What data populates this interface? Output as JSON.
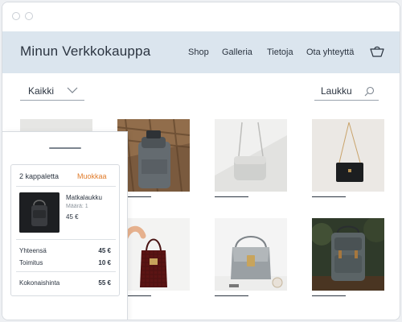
{
  "store": {
    "title": "Minun Verkkokauppa"
  },
  "nav": {
    "shop": "Shop",
    "gallery": "Galleria",
    "about": "Tietoja",
    "contact": "Ota yhteyttä"
  },
  "icons": {
    "cart": "shopping-cart-icon",
    "search": "search-icon",
    "chevron": "chevron-down-icon"
  },
  "filter": {
    "selected": "Kaikki"
  },
  "search": {
    "value": "Laukku"
  },
  "products": [
    {
      "name": ""
    },
    {
      "name": ""
    },
    {
      "name": ""
    },
    {
      "name": ""
    },
    {
      "name": ""
    },
    {
      "name": ""
    },
    {
      "name": ""
    },
    {
      "name": ""
    }
  ],
  "cart": {
    "count_label": "2 kappaletta",
    "edit_label": "Muokkaa",
    "item": {
      "name": "Matkalaukku",
      "qty": "Määrä: 1",
      "price": "45 €"
    },
    "subtotal_label": "Yhteensä",
    "subtotal_value": "45 €",
    "shipping_label": "Toimitus",
    "shipping_value": "10 €",
    "total_label": "Kokonaishinta",
    "total_value": "55 €"
  },
  "colors": {
    "header_bg": "#dbe5ee",
    "accent": "#e07b2a",
    "text": "#2b3440"
  }
}
